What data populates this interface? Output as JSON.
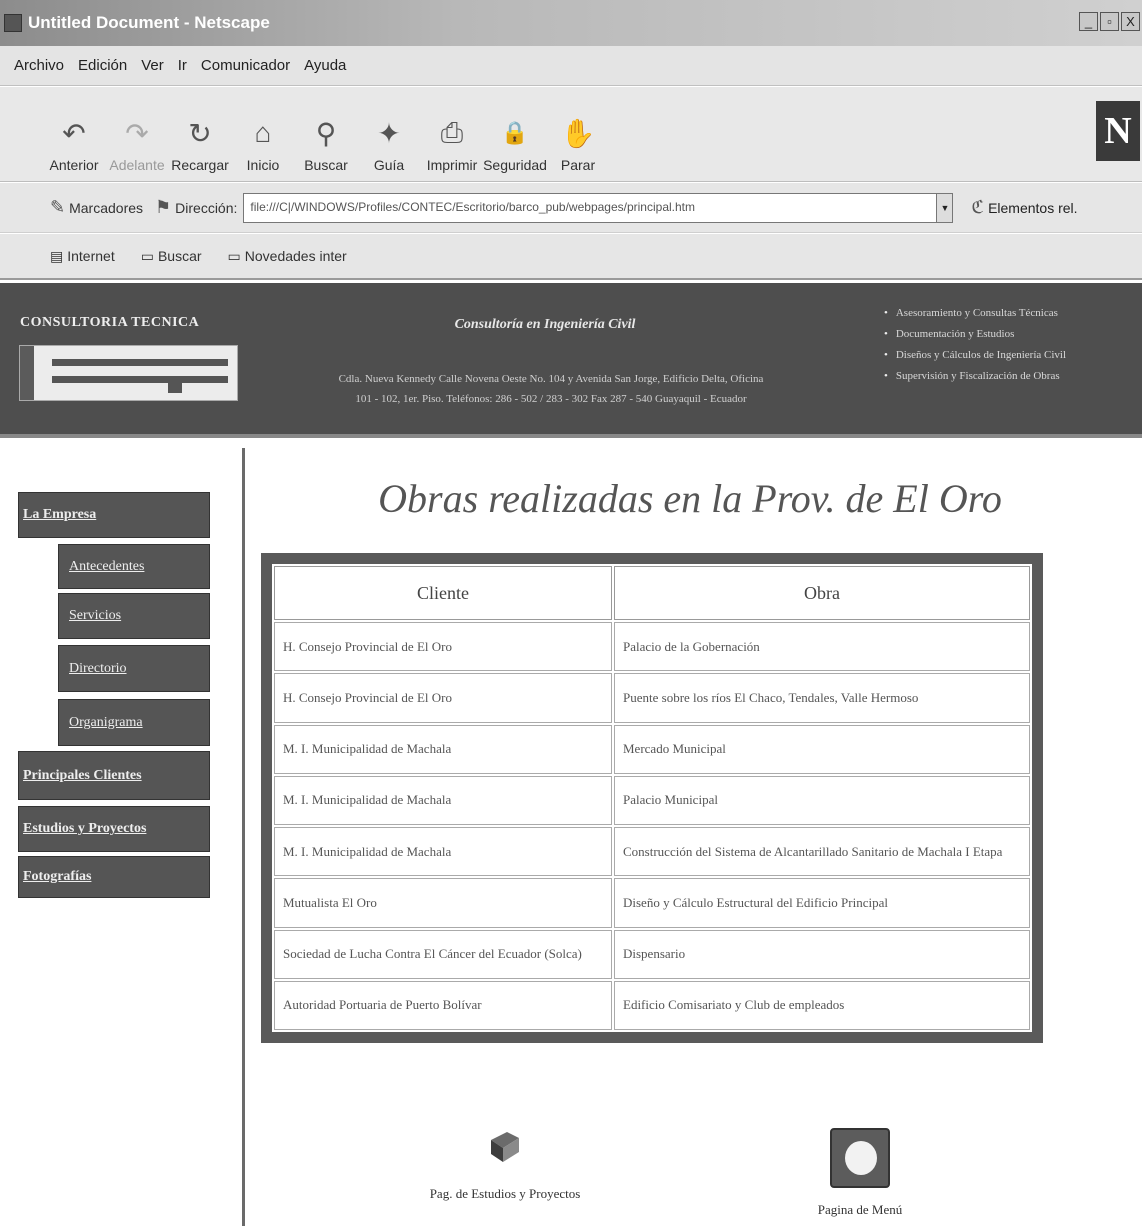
{
  "window": {
    "title": "Untitled Document - Netscape",
    "buttons": [
      "_",
      "▫",
      "X"
    ]
  },
  "menubar": [
    "Archivo",
    "Edición",
    "Ver",
    "Ir",
    "Comunicador",
    "Ayuda"
  ],
  "toolbar": [
    {
      "label": "Anterior",
      "icon": "back-arrow-icon",
      "glyph": "↶",
      "enabled": true
    },
    {
      "label": "Adelante",
      "icon": "forward-arrow-icon",
      "glyph": "↷",
      "enabled": false
    },
    {
      "label": "Recargar",
      "icon": "reload-icon",
      "glyph": "↻",
      "enabled": true
    },
    {
      "label": "Inicio",
      "icon": "home-icon",
      "glyph": "⌂",
      "enabled": true
    },
    {
      "label": "Buscar",
      "icon": "search-icon",
      "glyph": "⚲",
      "enabled": true
    },
    {
      "label": "Guía",
      "icon": "guide-icon",
      "glyph": "✦",
      "enabled": true
    },
    {
      "label": "Imprimir",
      "icon": "print-icon",
      "glyph": "⎙",
      "enabled": true
    },
    {
      "label": "Seguridad",
      "icon": "lock-icon",
      "glyph": "🔒",
      "enabled": true
    },
    {
      "label": "Parar",
      "icon": "stop-icon",
      "glyph": "✋",
      "enabled": true
    }
  ],
  "locationbar": {
    "bookmarks_label": "Marcadores",
    "address_label": "Dirección:",
    "url": "file:///C|/WINDOWS/Profiles/CONTEC/Escritorio/barco_pub/webpages/principal.htm",
    "related_label": "Elementos rel."
  },
  "personalbar": [
    "Internet",
    "Buscar",
    "Novedades inter"
  ],
  "banner": {
    "company": "CONSULTORIA TECNICA",
    "tagline": "Consultoría en Ingeniería Civil",
    "address_line1": "Cdla. Nueva Kennedy Calle Novena Oeste No. 104 y Avenida San Jorge, Edificio Delta, Oficina",
    "address_line2": "101 - 102, 1er. Piso. Teléfonos: 286 - 502 / 283 - 302 Fax 287 - 540 Guayaquil - Ecuador",
    "services": [
      "Asesoramiento y Consultas Técnicas",
      "Documentación y Estudios",
      "Diseños y Cálculos de Ingeniería Civil",
      "Supervisión y Fiscalización de Obras"
    ]
  },
  "sidebar": {
    "la_empresa": "La Empresa",
    "antecedentes": "Antecedentes",
    "servicios": "Servicios",
    "directorio": "Directorio",
    "organigrama": "Organigrama",
    "principales_clientes": "Principales Clientes",
    "estudios_proyectos": "Estudios y Proyectos",
    "fotografias": "Fotografías"
  },
  "page_title": "Obras realizadas en la Prov. de El Oro",
  "table": {
    "headers": [
      "Cliente",
      "Obra"
    ],
    "rows": [
      [
        "H. Consejo Provincial de El Oro",
        "Palacio de la Gobernación"
      ],
      [
        "H. Consejo Provincial de El Oro",
        "Puente sobre los ríos El Chaco, Tendales, Valle Hermoso"
      ],
      [
        "M. I. Municipalidad de Machala",
        "Mercado Municipal"
      ],
      [
        "M. I. Municipalidad de Machala",
        "Palacio Municipal"
      ],
      [
        "M. I. Municipalidad de Machala",
        "Construcción del Sistema de Alcantarillado Sanitario de Machala I Etapa"
      ],
      [
        "Mutualista El Oro",
        "Diseño y Cálculo Estructural del Edificio Principal"
      ],
      [
        "Sociedad de Lucha Contra El Cáncer del Ecuador (Solca)",
        "Dispensario"
      ],
      [
        "Autoridad Portuaria de Puerto Bolívar",
        "Edificio Comisariato y Club de empleados"
      ]
    ]
  },
  "footer": {
    "estudios_label": "Pag. de Estudios y Proyectos",
    "menu_label": "Pagina de Menú"
  }
}
